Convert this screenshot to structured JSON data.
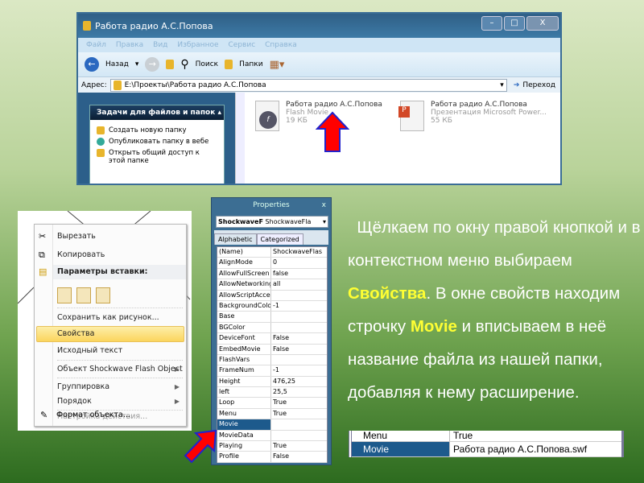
{
  "explorer": {
    "title": "Работа радио А.С.Попова",
    "menu": [
      "Файл",
      "Правка",
      "Вид",
      "Избранное",
      "Сервис",
      "Справка"
    ],
    "toolbar": {
      "back": "Назад",
      "search": "Поиск",
      "folders": "Папки"
    },
    "address_label": "Адрес:",
    "address": "E:\\Проекты\\Работа радио А.С.Попова",
    "go": "Переход",
    "tasks_header": "Задачи для файлов и папок",
    "tasks": [
      "Создать новую папку",
      "Опубликовать папку в вебе",
      "Открыть общий доступ к этой папке"
    ],
    "files": [
      {
        "name": "Работа радио А.С.Попова",
        "type": "Flash Movie",
        "size": "19 КБ"
      },
      {
        "name": "Работа радио А.С.Попова",
        "type": "Презентация Microsoft Power...",
        "size": "55 КБ"
      }
    ]
  },
  "context_menu": {
    "items": [
      "Вырезать",
      "Копировать",
      "Параметры вставки:",
      "Сохранить как рисунок...",
      "Свойства",
      "Исходный текст",
      "Объект Shockwave Flash Object",
      "Группировка",
      "Порядок",
      "Настройка действия...",
      "Формат объекта..."
    ]
  },
  "properties": {
    "title": "Properties",
    "close": "x",
    "object_bold": "ShockwaveF",
    "object_type": "ShockwaveFla",
    "tabs": [
      "Alphabetic",
      "Categorized"
    ],
    "rows": [
      [
        "(Name)",
        "ShockwaveFlas"
      ],
      [
        "AlignMode",
        "0"
      ],
      [
        "AllowFullScreen",
        "false"
      ],
      [
        "AllowNetworking",
        "all"
      ],
      [
        "AllowScriptAcces",
        ""
      ],
      [
        "BackgroundColor",
        "-1"
      ],
      [
        "Base",
        ""
      ],
      [
        "BGColor",
        ""
      ],
      [
        "DeviceFont",
        "False"
      ],
      [
        "EmbedMovie",
        "False"
      ],
      [
        "FlashVars",
        ""
      ],
      [
        "FrameNum",
        "-1"
      ],
      [
        "Height",
        "476,25"
      ],
      [
        "left",
        "25,5"
      ],
      [
        "Loop",
        "True"
      ],
      [
        "Menu",
        "True"
      ],
      [
        "Movie",
        ""
      ],
      [
        "MovieData",
        ""
      ],
      [
        "Playing",
        "True"
      ],
      [
        "Profile",
        "False"
      ]
    ]
  },
  "instruction": {
    "p1": "Щёлкаем по окну правой кнопкой и в контекстном меню выбираем ",
    "h1": "Свойства",
    "p2": ". В окне свойств находим строчку ",
    "h2": "Movie",
    "p3": " и вписываем в неё название файла из нашей папки, добавляя к нему расширение."
  },
  "movie_strip": {
    "prev_key": "Menu",
    "prev_val": "True",
    "key": "Movie",
    "value": "Работа радио А.С.Попова.swf"
  }
}
